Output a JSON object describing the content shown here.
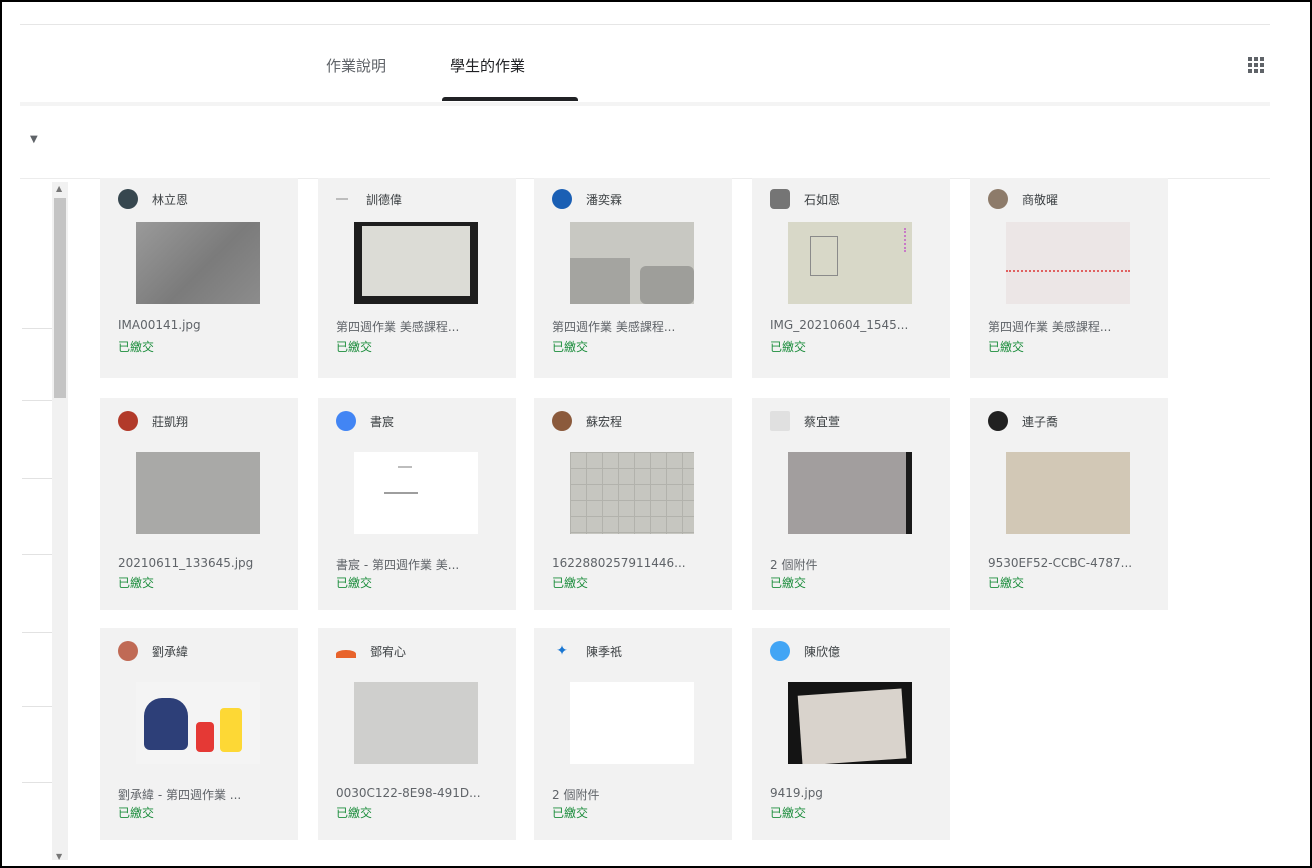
{
  "header": {
    "tabs": [
      {
        "label": "作業說明",
        "active": false
      },
      {
        "label": "學生的作業",
        "active": true
      }
    ],
    "apps_icon": "grid-apps-icon"
  },
  "colors": {
    "status_green": "#1e8e3e",
    "card_bg": "#f2f2f2",
    "tab_indicator": "#202124"
  },
  "submissions": [
    {
      "name": "林立恩",
      "file": "IMA00141.jpg",
      "status": "已繳交",
      "avatar_color": "#37474f",
      "thumb": "gray-dark"
    },
    {
      "name": "訓德偉",
      "file": "第四週作業 美感課程...",
      "status": "已繳交",
      "avatar_color": "#bdbdbd",
      "thumb": "paper-on-black"
    },
    {
      "name": "潘奕霖",
      "file": "第四週作業 美感課程...",
      "status": "已繳交",
      "avatar_color": "#1a5fb4",
      "thumb": "gray-light"
    },
    {
      "name": "石如恩",
      "file": "IMG_20210604_1545...",
      "status": "已繳交",
      "avatar_color": "#757575",
      "thumb": "sketch-paper"
    },
    {
      "name": "商敬曜",
      "file": "第四週作業 美感課程...",
      "status": "已繳交",
      "avatar_color": "#8d7b6a",
      "thumb": "pink-paper"
    },
    {
      "name": "莊凱翔",
      "file": "20210611_133645.jpg",
      "status": "已繳交",
      "avatar_color": "#b23a2a",
      "thumb": "gray-mid"
    },
    {
      "name": "書宸",
      "file": "書宸 - 第四週作業 美...",
      "status": "已繳交",
      "avatar_color": "#4285f4",
      "thumb": "white-doc"
    },
    {
      "name": "蘇宏程",
      "file": "1622880257911446...",
      "status": "已繳交",
      "avatar_color": "#8b5a3c",
      "thumb": "grid-paper"
    },
    {
      "name": "蔡宜萱",
      "file": "2 個附件",
      "status": "已繳交",
      "avatar_color": "#e0e0e0",
      "thumb": "dark-paper"
    },
    {
      "name": "連子喬",
      "file": "9530EF52-CCBC-4787...",
      "status": "已繳交",
      "avatar_color": "#212121",
      "thumb": "beige-paper"
    },
    {
      "name": "劉承緯",
      "file": "劉承緯 - 第四週作業 ...",
      "status": "已繳交",
      "avatar_color": "#c06a55",
      "thumb": "cartoon"
    },
    {
      "name": "鄧宥心",
      "file": "0030C122-8E98-491D...",
      "status": "已繳交",
      "avatar_color": "#e8632b",
      "thumb": "gray-light2"
    },
    {
      "name": "陳季祇",
      "file": "2 個附件",
      "status": "已繳交",
      "avatar_color": "#1976d2",
      "thumb": "blank"
    },
    {
      "name": "陳欣億",
      "file": "9419.jpg",
      "status": "已繳交",
      "avatar_color": "#42a5f5",
      "thumb": "framed-photo"
    }
  ]
}
